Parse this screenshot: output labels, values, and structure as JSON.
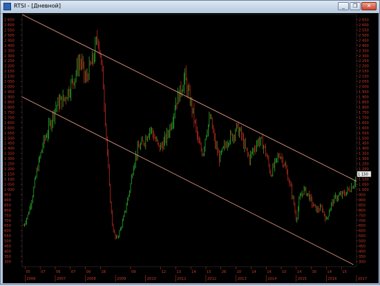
{
  "window": {
    "title": "RTSI - [Дневной]",
    "minimize_label": "_",
    "restore_label": "❐",
    "close_label": "✕"
  },
  "chart_data": {
    "type": "candlestick",
    "title": "RTSI - [Дневной]",
    "y_range": [
      250,
      2700
    ],
    "y_ticks": [
      300,
      350,
      400,
      450,
      500,
      550,
      600,
      650,
      700,
      750,
      800,
      850,
      900,
      950,
      1000,
      1050,
      1100,
      1150,
      1200,
      1250,
      1300,
      1350,
      1400,
      1450,
      1500,
      1550,
      1600,
      1650,
      1700,
      1750,
      1800,
      1850,
      1900,
      1950,
      2000,
      2050,
      2100,
      2150,
      2200,
      2250,
      2300,
      2350,
      2400,
      2450,
      2500,
      2550,
      2600,
      2650
    ],
    "y_tick_labels": [
      "300",
      "350",
      "400",
      "450",
      "500",
      "550",
      "600",
      "650",
      "700",
      "750",
      "800",
      "850",
      "900",
      "950",
      "1 000",
      "1 050",
      "1 100",
      "1 150",
      "1 200",
      "1 250",
      "1 300",
      "1 350",
      "1 400",
      "1 450",
      "1 500",
      "1 550",
      "1 600",
      "1 650",
      "1 700",
      "1 750",
      "1 800",
      "1 850",
      "1 900",
      "1 950",
      "2 000",
      "2 050",
      "2 100",
      "2 150",
      "2 200",
      "2 250",
      "2 300",
      "2 350",
      "2 400",
      "2 450",
      "2 500",
      "2 550",
      "2 600",
      "2 650"
    ],
    "x_range": [
      2005.9,
      2017.0
    ],
    "month_labels": [
      {
        "t": 2006.0,
        "text": "05"
      },
      {
        "t": 2006.5,
        "text": "07"
      },
      {
        "t": 2007.0,
        "text": "06"
      },
      {
        "t": 2007.5,
        "text": "07"
      },
      {
        "t": 2008.0,
        "text": "09"
      },
      {
        "t": 2008.5,
        "text": "18"
      },
      {
        "t": 2009.5,
        "text": "09"
      },
      {
        "t": 2010.5,
        "text": "12"
      },
      {
        "t": 2011.0,
        "text": "13"
      },
      {
        "t": 2011.5,
        "text": "14"
      },
      {
        "t": 2012.0,
        "text": "15"
      },
      {
        "t": 2012.5,
        "text": "26"
      },
      {
        "t": 2013.0,
        "text": "10"
      },
      {
        "t": 2013.5,
        "text": "14"
      },
      {
        "t": 2014.0,
        "text": "14"
      },
      {
        "t": 2014.5,
        "text": "10"
      },
      {
        "t": 2015.0,
        "text": "14"
      },
      {
        "t": 2015.5,
        "text": "30"
      },
      {
        "t": 2016.0,
        "text": "14"
      },
      {
        "t": 2016.5,
        "text": "15"
      }
    ],
    "year_labels": [
      {
        "t": 2006.0,
        "text": "2006"
      },
      {
        "t": 2007.0,
        "text": "2007"
      },
      {
        "t": 2008.0,
        "text": "2008"
      },
      {
        "t": 2009.0,
        "text": "2009"
      },
      {
        "t": 2010.0,
        "text": "2010"
      },
      {
        "t": 2011.0,
        "text": "2011"
      },
      {
        "t": 2012.0,
        "text": "2012"
      },
      {
        "t": 2013.0,
        "text": "2013"
      },
      {
        "t": 2014.0,
        "text": "2014"
      },
      {
        "t": 2015.0,
        "text": "2015"
      },
      {
        "t": 2016.0,
        "text": "2016"
      },
      {
        "t": 2017.0,
        "text": "2017"
      }
    ],
    "series": [
      {
        "points": [
          [
            2005.95,
            650
          ],
          [
            2006.1,
            760
          ],
          [
            2006.25,
            950
          ],
          [
            2006.4,
            1200
          ],
          [
            2006.5,
            1320
          ],
          [
            2006.6,
            1450
          ],
          [
            2006.75,
            1560
          ],
          [
            2006.9,
            1700
          ],
          [
            2007.0,
            1800
          ],
          [
            2007.15,
            1850
          ],
          [
            2007.3,
            1880
          ],
          [
            2007.5,
            2000
          ],
          [
            2007.65,
            2100
          ],
          [
            2007.8,
            2250
          ],
          [
            2007.9,
            2200
          ],
          [
            2008.0,
            2050
          ],
          [
            2008.1,
            2150
          ],
          [
            2008.25,
            2250
          ],
          [
            2008.35,
            2400
          ],
          [
            2008.42,
            2500
          ],
          [
            2008.5,
            2300
          ],
          [
            2008.6,
            2000
          ],
          [
            2008.7,
            1500
          ],
          [
            2008.8,
            1000
          ],
          [
            2008.9,
            650
          ],
          [
            2009.0,
            520
          ],
          [
            2009.1,
            560
          ],
          [
            2009.25,
            700
          ],
          [
            2009.4,
            900
          ],
          [
            2009.5,
            1050
          ],
          [
            2009.6,
            1250
          ],
          [
            2009.75,
            1400
          ],
          [
            2009.9,
            1450
          ],
          [
            2010.0,
            1500
          ],
          [
            2010.15,
            1600
          ],
          [
            2010.3,
            1500
          ],
          [
            2010.45,
            1400
          ],
          [
            2010.6,
            1450
          ],
          [
            2010.75,
            1550
          ],
          [
            2010.9,
            1700
          ],
          [
            2011.0,
            1850
          ],
          [
            2011.15,
            1950
          ],
          [
            2011.3,
            2100
          ],
          [
            2011.4,
            1950
          ],
          [
            2011.5,
            1850
          ],
          [
            2011.6,
            1700
          ],
          [
            2011.75,
            1450
          ],
          [
            2011.9,
            1350
          ],
          [
            2012.0,
            1550
          ],
          [
            2012.15,
            1700
          ],
          [
            2012.3,
            1450
          ],
          [
            2012.45,
            1300
          ],
          [
            2012.6,
            1400
          ],
          [
            2012.75,
            1500
          ],
          [
            2012.9,
            1520
          ],
          [
            2013.0,
            1600
          ],
          [
            2013.15,
            1550
          ],
          [
            2013.3,
            1400
          ],
          [
            2013.45,
            1300
          ],
          [
            2013.6,
            1400
          ],
          [
            2013.75,
            1480
          ],
          [
            2013.9,
            1440
          ],
          [
            2014.0,
            1350
          ],
          [
            2014.15,
            1150
          ],
          [
            2014.3,
            1250
          ],
          [
            2014.45,
            1350
          ],
          [
            2014.6,
            1250
          ],
          [
            2014.75,
            1100
          ],
          [
            2014.9,
            900
          ],
          [
            2015.0,
            700
          ],
          [
            2015.1,
            900
          ],
          [
            2015.25,
            1000
          ],
          [
            2015.4,
            950
          ],
          [
            2015.55,
            850
          ],
          [
            2015.7,
            800
          ],
          [
            2015.85,
            820
          ],
          [
            2016.0,
            700
          ],
          [
            2016.15,
            850
          ],
          [
            2016.3,
            920
          ],
          [
            2016.45,
            940
          ],
          [
            2016.6,
            960
          ],
          [
            2016.75,
            1000
          ],
          [
            2016.9,
            1050
          ],
          [
            2017.0,
            1150
          ]
        ]
      }
    ],
    "last_price": "1 150",
    "channel_lines": [
      {
        "name": "upper",
        "from": [
          2005.9,
          2700
        ],
        "to": [
          2017.0,
          1080
        ]
      },
      {
        "name": "lower",
        "from": [
          2005.9,
          1900
        ],
        "to": [
          2016.9,
          270
        ]
      }
    ],
    "colors": {
      "background": "#000000",
      "up": "#2ec82e",
      "down": "#e0311f",
      "axis_text": "#d23a2a",
      "grid": "#4a4a4a",
      "channel": "#f0a08a",
      "label_bg": "#e8e8e8"
    }
  }
}
